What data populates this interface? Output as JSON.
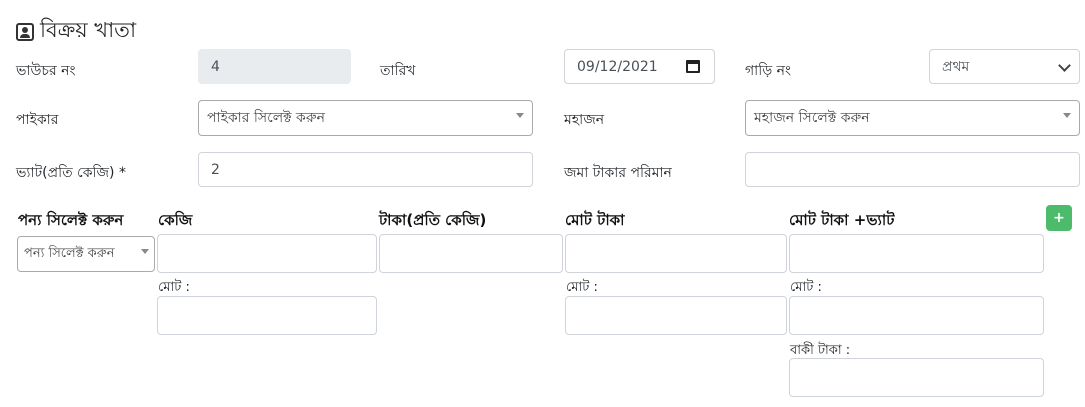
{
  "page": {
    "title": "বিক্রয় খাতা",
    "title_icon": "contact-card-icon"
  },
  "voucher": {
    "label": "ভাউচর নং",
    "value": "4"
  },
  "date": {
    "label": "তারিখ",
    "value": "09/12/2021"
  },
  "vehicle": {
    "label": "গাড়ি নং",
    "selected": "প্রথম"
  },
  "paikar": {
    "label": "পাইকার",
    "placeholder": "পাইকার সিলেক্ট করুন"
  },
  "mahajan": {
    "label": "মহাজন",
    "placeholder": "মহাজন সিলেক্ট করুন"
  },
  "vat": {
    "label": "ভ্যাট(প্রতি কেজি) *",
    "value": "2"
  },
  "deposit": {
    "label": "জমা টাকার পরিমান",
    "value": ""
  },
  "items": {
    "col_product": "পন্য সিলেক্ট করুন",
    "col_kg": "কেজি",
    "col_rate": "টাকা(প্রতি কেজি)",
    "col_total": "মোট টাকা",
    "col_total_vat": "মোট টাকা +ভ্যাট",
    "product_placeholder": "পন্য সিলেক্ট করুন",
    "add_label": "+"
  },
  "summary": {
    "kg_total_label": "মোট :",
    "total_label": "মোট :",
    "total_vat_label": "মোট :",
    "due_label": "বাকী টাকা :"
  },
  "colors": {
    "add_button": "#4cbb6c",
    "readonly_bg": "#e9ecef"
  }
}
